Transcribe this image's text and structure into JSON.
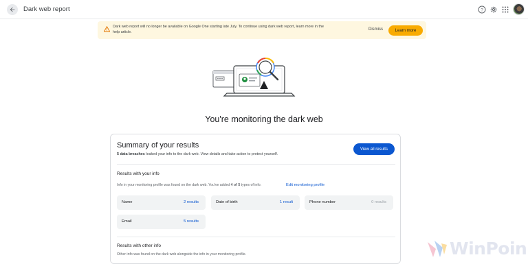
{
  "header": {
    "title": "Dark web report",
    "back_icon": "arrow-back-icon",
    "help_icon": "help-icon",
    "settings_icon": "gear-icon",
    "apps_icon": "apps-grid-icon"
  },
  "banner": {
    "message": "Dark web report will no longer be available on Google One starting late July. To continue using dark web report, learn more in the help article.",
    "dismiss_label": "Dismiss",
    "learn_more_label": "Learn more",
    "color": "#fef7e0",
    "button_color": "#f9ab00"
  },
  "main": {
    "headline": "You're monitoring the dark web"
  },
  "summary": {
    "title": "Summary of your results",
    "breach_count": "5 data breaches",
    "subtitle_rest": " leaked your info to the dark web. View details and take action to protect yourself.",
    "view_all_label": "View all results",
    "accent": "#0b57d0"
  },
  "results_your_info": {
    "title": "Results with your info",
    "desc_prefix": "Info in your monitoring profile was found on the dark web. You've added ",
    "desc_bold": "4 of 5",
    "desc_suffix": " types of info.",
    "edit_label": "Edit monitoring profile",
    "items": [
      {
        "label": "Name",
        "value": "2 results"
      },
      {
        "label": "Date of birth",
        "value": "1 result"
      },
      {
        "label": "Phone number",
        "value": "0 results"
      },
      {
        "label": "Email",
        "value": "5 results"
      }
    ]
  },
  "results_other_info": {
    "title": "Results with other info",
    "desc": "Other info was found on the dark web alongside the info in your monitoring profile."
  },
  "watermark": {
    "text": "WinPoin"
  }
}
